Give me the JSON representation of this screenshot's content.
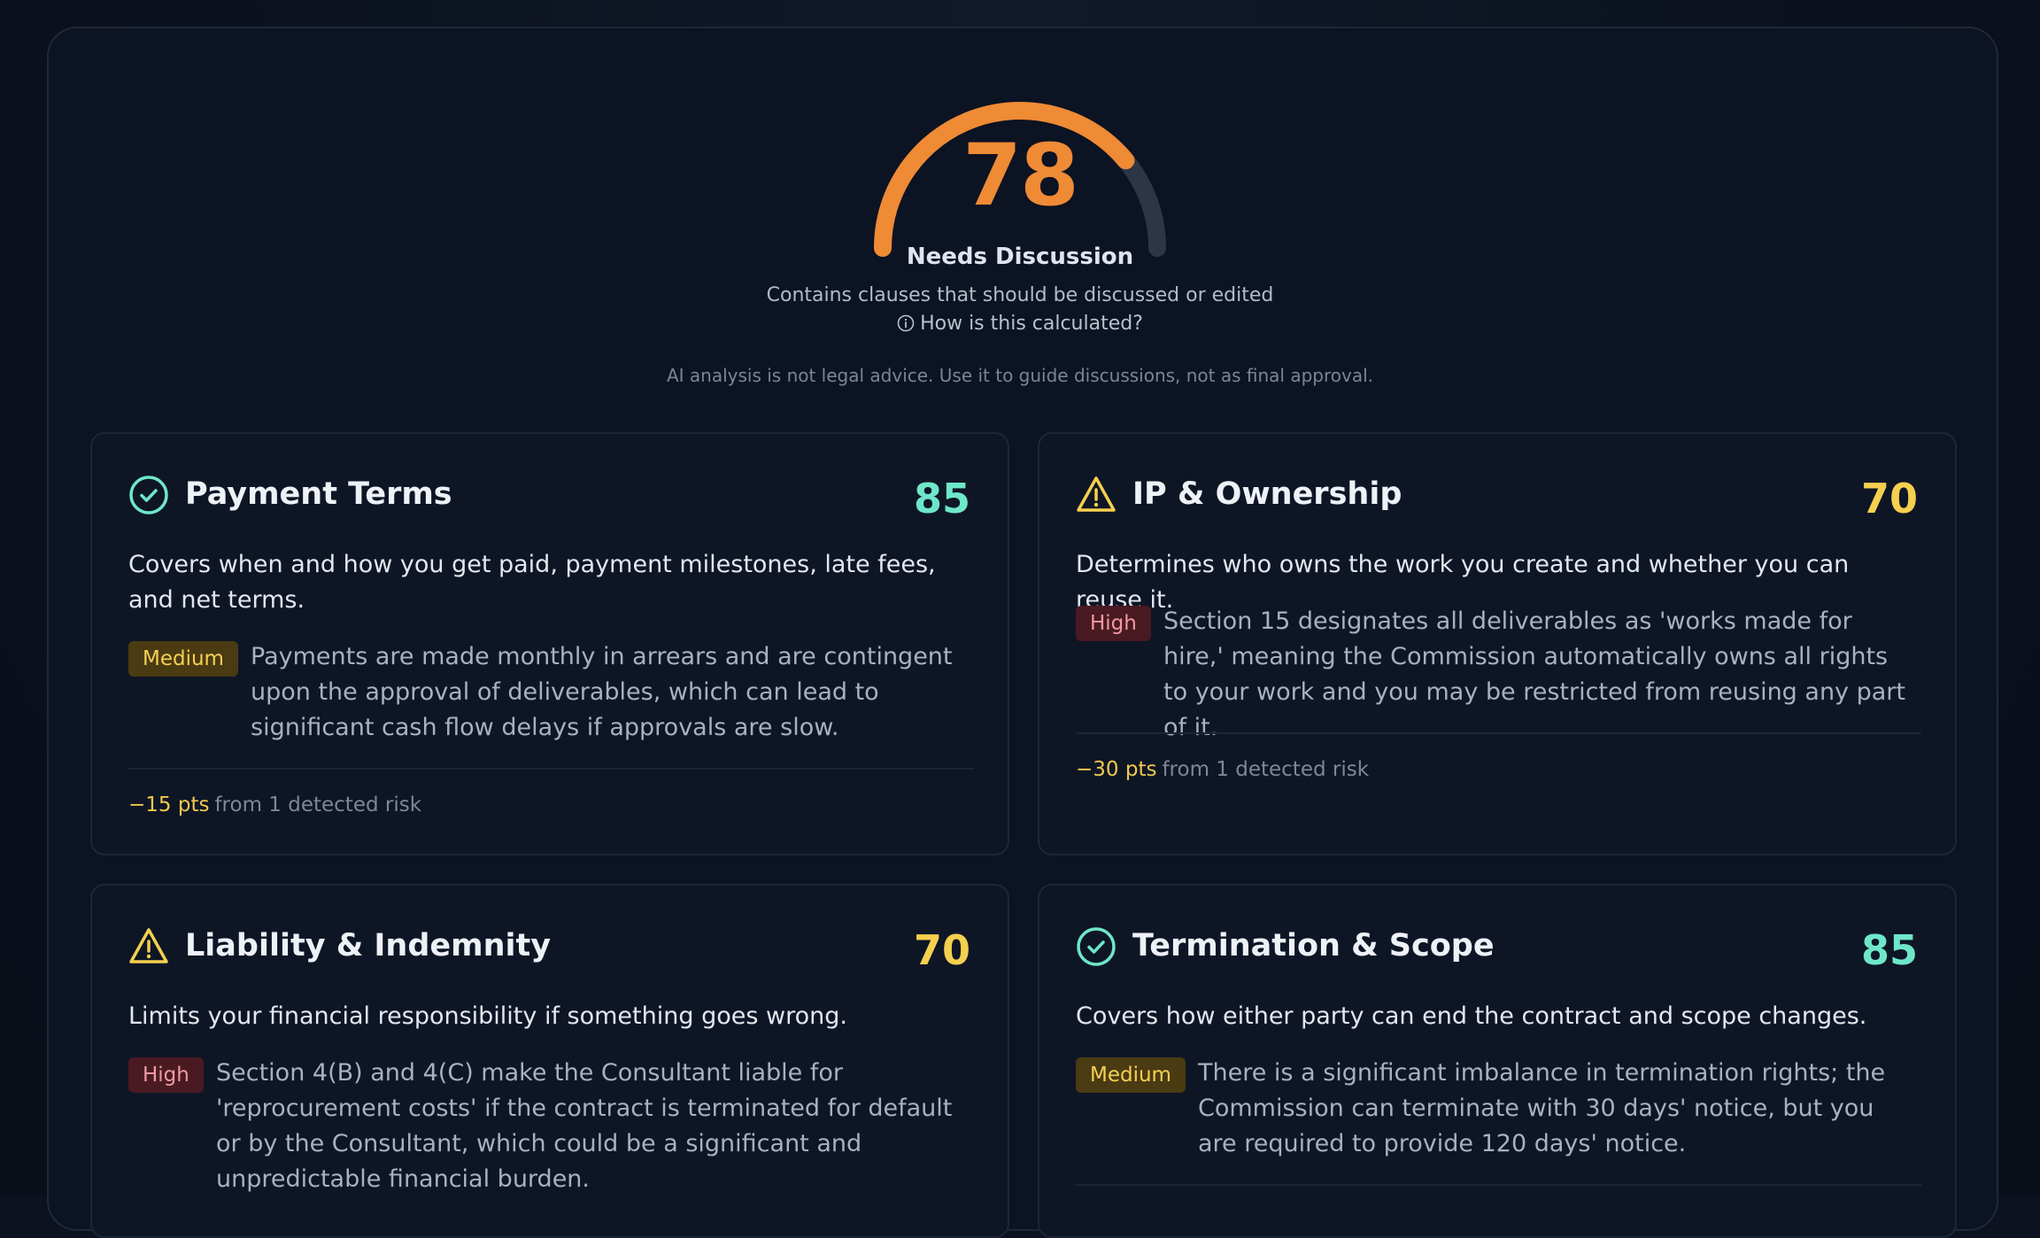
{
  "summary": {
    "score": "78",
    "score_fraction": 0.78,
    "verdict": "Needs Discussion",
    "description": "Contains clauses that should be discussed or edited",
    "how_link": "How is this calculated?",
    "disclaimer": "AI analysis is not legal advice. Use it to guide discussions, not as final approval."
  },
  "colors": {
    "gauge_fill": "#ef8a35",
    "gauge_track": "#2d3645",
    "good": "#6ee7c8",
    "warn": "#f5cf4e",
    "medium_badge_bg": "#4a3b12",
    "high_badge_bg": "#4a1a23"
  },
  "cards": [
    {
      "icon": "check-circle-icon",
      "title": "Payment Terms",
      "score": "85",
      "description": "Covers when and how you get paid, payment milestones, late fees, and net terms.",
      "risk": {
        "level": "Medium",
        "text": "Payments are made monthly in arrears and are contingent upon the approval of deliverables, which can lead to significant cash flow delays if approvals are slow."
      },
      "points_delta": "−15 pts",
      "points_note": "from 1 detected risk"
    },
    {
      "icon": "warning-triangle-icon",
      "title": "IP & Ownership",
      "score": "70",
      "description": "Determines who owns the work you create and whether you can reuse it.",
      "risk": {
        "level": "High",
        "text": "Section 15 designates all deliverables as 'works made for hire,' meaning the Commission automatically owns all rights to your work and you may be restricted from reusing any part of it."
      },
      "points_delta": "−30 pts",
      "points_note": "from 1 detected risk"
    },
    {
      "icon": "warning-triangle-icon",
      "title": "Liability & Indemnity",
      "score": "70",
      "description": "Limits your financial responsibility if something goes wrong.",
      "risk": {
        "level": "High",
        "text": "Section 4(B) and 4(C) make the Consultant liable for 'reprocurement costs' if the contract is terminated for default or by the Consultant, which could be a significant and unpredictable financial burden."
      }
    },
    {
      "icon": "check-circle-icon",
      "title": "Termination & Scope",
      "score": "85",
      "description": "Covers how either party can end the contract and scope changes.",
      "risk": {
        "level": "Medium",
        "text": "There is a significant imbalance in termination rights; the Commission can terminate with 30 days' notice, but you are required to provide 120 days' notice."
      }
    }
  ]
}
